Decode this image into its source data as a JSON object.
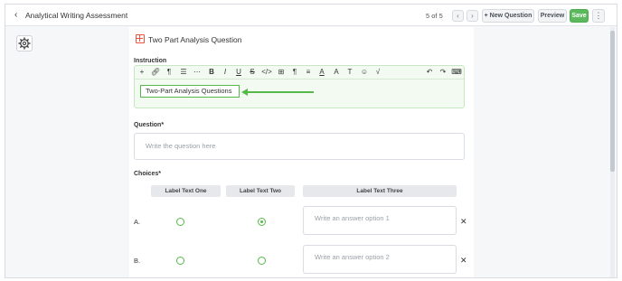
{
  "header": {
    "title": "Analytical Writing Assessment",
    "pager": "5 of 5",
    "new_question": "New Question",
    "preview": "Preview",
    "save": "Save"
  },
  "question_type": {
    "title": "Two Part Analysis Question",
    "icon": "grid-icon"
  },
  "instruction": {
    "label": "Instruction",
    "content": "Two-Part Analysis Questions",
    "toolbar_icons": [
      "plus-icon",
      "link-icon",
      "paragraph-icon",
      "list-icon",
      "more-icon",
      "bold-icon",
      "italic-icon",
      "underline-icon",
      "strikethrough-icon",
      "code-icon",
      "table-icon",
      "pilcrow-icon",
      "align-icon",
      "text-color-icon",
      "font-icon",
      "text-size-icon",
      "emoji-icon",
      "math-icon",
      "undo-icon",
      "redo-icon",
      "keyboard-icon"
    ]
  },
  "question": {
    "label": "Question*",
    "placeholder": "Write the question here"
  },
  "choices": {
    "label": "Choices*",
    "columns": [
      "Label Text One",
      "Label Text Two",
      "Label Text Three"
    ],
    "rows": [
      {
        "label": "A.",
        "placeholder": "Write an answer option 1",
        "col1_checked": false,
        "col2_checked": true
      },
      {
        "label": "B.",
        "placeholder": "Write an answer option 2",
        "col1_checked": false,
        "col2_checked": false
      }
    ]
  },
  "colors": {
    "accent": "#54b948",
    "type_icon": "#e8543d"
  }
}
